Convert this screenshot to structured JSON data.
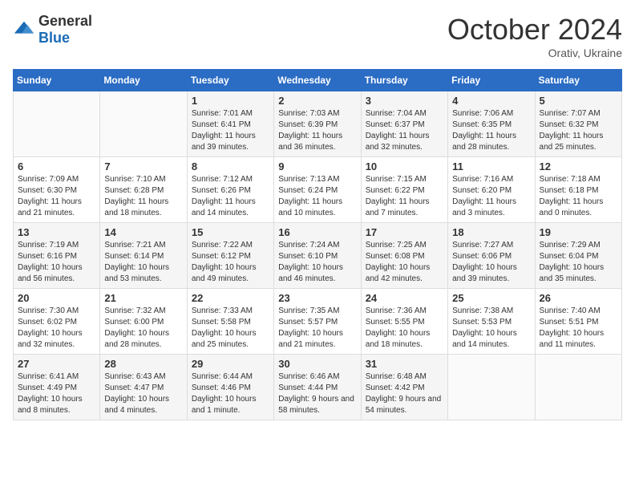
{
  "header": {
    "logo_general": "General",
    "logo_blue": "Blue",
    "month_title": "October 2024",
    "subtitle": "Orativ, Ukraine"
  },
  "weekdays": [
    "Sunday",
    "Monday",
    "Tuesday",
    "Wednesday",
    "Thursday",
    "Friday",
    "Saturday"
  ],
  "weeks": [
    [
      {
        "day": "",
        "info": ""
      },
      {
        "day": "",
        "info": ""
      },
      {
        "day": "1",
        "info": "Sunrise: 7:01 AM\nSunset: 6:41 PM\nDaylight: 11 hours and 39 minutes."
      },
      {
        "day": "2",
        "info": "Sunrise: 7:03 AM\nSunset: 6:39 PM\nDaylight: 11 hours and 36 minutes."
      },
      {
        "day": "3",
        "info": "Sunrise: 7:04 AM\nSunset: 6:37 PM\nDaylight: 11 hours and 32 minutes."
      },
      {
        "day": "4",
        "info": "Sunrise: 7:06 AM\nSunset: 6:35 PM\nDaylight: 11 hours and 28 minutes."
      },
      {
        "day": "5",
        "info": "Sunrise: 7:07 AM\nSunset: 6:32 PM\nDaylight: 11 hours and 25 minutes."
      }
    ],
    [
      {
        "day": "6",
        "info": "Sunrise: 7:09 AM\nSunset: 6:30 PM\nDaylight: 11 hours and 21 minutes."
      },
      {
        "day": "7",
        "info": "Sunrise: 7:10 AM\nSunset: 6:28 PM\nDaylight: 11 hours and 18 minutes."
      },
      {
        "day": "8",
        "info": "Sunrise: 7:12 AM\nSunset: 6:26 PM\nDaylight: 11 hours and 14 minutes."
      },
      {
        "day": "9",
        "info": "Sunrise: 7:13 AM\nSunset: 6:24 PM\nDaylight: 11 hours and 10 minutes."
      },
      {
        "day": "10",
        "info": "Sunrise: 7:15 AM\nSunset: 6:22 PM\nDaylight: 11 hours and 7 minutes."
      },
      {
        "day": "11",
        "info": "Sunrise: 7:16 AM\nSunset: 6:20 PM\nDaylight: 11 hours and 3 minutes."
      },
      {
        "day": "12",
        "info": "Sunrise: 7:18 AM\nSunset: 6:18 PM\nDaylight: 11 hours and 0 minutes."
      }
    ],
    [
      {
        "day": "13",
        "info": "Sunrise: 7:19 AM\nSunset: 6:16 PM\nDaylight: 10 hours and 56 minutes."
      },
      {
        "day": "14",
        "info": "Sunrise: 7:21 AM\nSunset: 6:14 PM\nDaylight: 10 hours and 53 minutes."
      },
      {
        "day": "15",
        "info": "Sunrise: 7:22 AM\nSunset: 6:12 PM\nDaylight: 10 hours and 49 minutes."
      },
      {
        "day": "16",
        "info": "Sunrise: 7:24 AM\nSunset: 6:10 PM\nDaylight: 10 hours and 46 minutes."
      },
      {
        "day": "17",
        "info": "Sunrise: 7:25 AM\nSunset: 6:08 PM\nDaylight: 10 hours and 42 minutes."
      },
      {
        "day": "18",
        "info": "Sunrise: 7:27 AM\nSunset: 6:06 PM\nDaylight: 10 hours and 39 minutes."
      },
      {
        "day": "19",
        "info": "Sunrise: 7:29 AM\nSunset: 6:04 PM\nDaylight: 10 hours and 35 minutes."
      }
    ],
    [
      {
        "day": "20",
        "info": "Sunrise: 7:30 AM\nSunset: 6:02 PM\nDaylight: 10 hours and 32 minutes."
      },
      {
        "day": "21",
        "info": "Sunrise: 7:32 AM\nSunset: 6:00 PM\nDaylight: 10 hours and 28 minutes."
      },
      {
        "day": "22",
        "info": "Sunrise: 7:33 AM\nSunset: 5:58 PM\nDaylight: 10 hours and 25 minutes."
      },
      {
        "day": "23",
        "info": "Sunrise: 7:35 AM\nSunset: 5:57 PM\nDaylight: 10 hours and 21 minutes."
      },
      {
        "day": "24",
        "info": "Sunrise: 7:36 AM\nSunset: 5:55 PM\nDaylight: 10 hours and 18 minutes."
      },
      {
        "day": "25",
        "info": "Sunrise: 7:38 AM\nSunset: 5:53 PM\nDaylight: 10 hours and 14 minutes."
      },
      {
        "day": "26",
        "info": "Sunrise: 7:40 AM\nSunset: 5:51 PM\nDaylight: 10 hours and 11 minutes."
      }
    ],
    [
      {
        "day": "27",
        "info": "Sunrise: 6:41 AM\nSunset: 4:49 PM\nDaylight: 10 hours and 8 minutes."
      },
      {
        "day": "28",
        "info": "Sunrise: 6:43 AM\nSunset: 4:47 PM\nDaylight: 10 hours and 4 minutes."
      },
      {
        "day": "29",
        "info": "Sunrise: 6:44 AM\nSunset: 4:46 PM\nDaylight: 10 hours and 1 minute."
      },
      {
        "day": "30",
        "info": "Sunrise: 6:46 AM\nSunset: 4:44 PM\nDaylight: 9 hours and 58 minutes."
      },
      {
        "day": "31",
        "info": "Sunrise: 6:48 AM\nSunset: 4:42 PM\nDaylight: 9 hours and 54 minutes."
      },
      {
        "day": "",
        "info": ""
      },
      {
        "day": "",
        "info": ""
      }
    ]
  ]
}
